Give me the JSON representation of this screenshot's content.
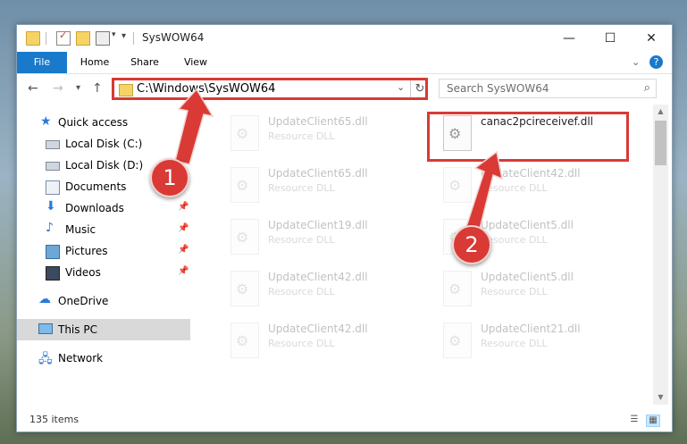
{
  "window": {
    "title": "SysWOW64"
  },
  "ribbon": {
    "tabs": [
      "File",
      "Home",
      "Share",
      "View"
    ],
    "help": "?"
  },
  "address": {
    "path": "C:\\Windows\\SysWOW64",
    "search_placeholder": "Search SysWOW64"
  },
  "sidebar": {
    "items": [
      {
        "label": "Quick access",
        "icon": "star-icon"
      },
      {
        "label": "Local Disk (C:)",
        "icon": "disk-icon"
      },
      {
        "label": "Local Disk (D:)",
        "icon": "disk-icon"
      },
      {
        "label": "Documents",
        "icon": "documents-icon"
      },
      {
        "label": "Downloads",
        "icon": "downloads-icon"
      },
      {
        "label": "Music",
        "icon": "music-icon"
      },
      {
        "label": "Pictures",
        "icon": "pictures-icon"
      },
      {
        "label": "Videos",
        "icon": "videos-icon"
      },
      {
        "label": "OneDrive",
        "icon": "cloud-icon"
      },
      {
        "label": "This PC",
        "icon": "computer-icon"
      },
      {
        "label": "Network",
        "icon": "network-icon"
      }
    ]
  },
  "files": {
    "left": [
      {
        "name": "UpdateClient65.dll",
        "type": "Resource DLL"
      },
      {
        "name": "UpdateClient65.dll",
        "type": "Resource DLL"
      },
      {
        "name": "UpdateClient19.dll",
        "type": "Resource DLL"
      },
      {
        "name": "UpdateClient42.dll",
        "type": "Resource DLL"
      },
      {
        "name": "UpdateClient42.dll",
        "type": "Resource DLL"
      }
    ],
    "right": [
      {
        "name": "canac2pcireceivef.dll",
        "type": ""
      },
      {
        "name": "UpdateClient42.dll",
        "type": "Resource DLL"
      },
      {
        "name": "UpdateClient5.dll",
        "type": "Resource DLL"
      },
      {
        "name": "UpdateClient5.dll",
        "type": "Resource DLL"
      },
      {
        "name": "UpdateClient21.dll",
        "type": "Resource DLL"
      }
    ]
  },
  "status": {
    "count": "135 items"
  },
  "annotations": {
    "step1": "1",
    "step2": "2",
    "color": "#d93a35"
  }
}
